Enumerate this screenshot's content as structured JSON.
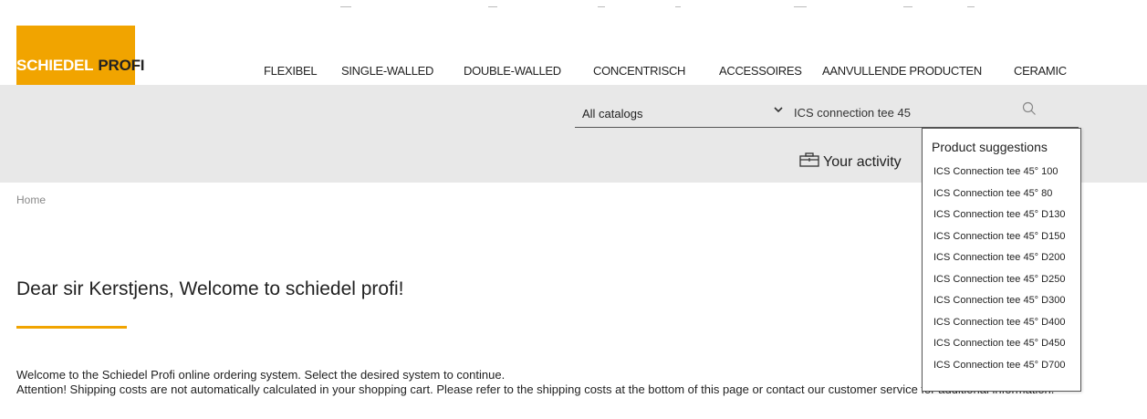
{
  "logo": {
    "word1": "SCHIEDEL",
    "word2": "PROFI"
  },
  "nav": [
    "FLEXIBEL",
    "SINGLE-WALLED",
    "DOUBLE-WALLED",
    "CONCENTRISCH",
    "ACCESSOIRES",
    "AANVULLENDE PRODUCTEN",
    "CERAMIC"
  ],
  "search": {
    "catalog": "All catalogs",
    "query": "ICS connection tee 45"
  },
  "activity": {
    "label": "Your activity"
  },
  "breadcrumb": {
    "home": "Home"
  },
  "main": {
    "title": "Dear sir Kerstjens, Welcome to schiedel profi!",
    "para1": "Welcome to the Schiedel Profi online ordering system. Select the desired system to continue.",
    "para2": "Attention! Shipping costs are not automatically calculated in your shopping cart. Please refer to the shipping costs at the bottom of this page or contact our customer service for additional information."
  },
  "suggestions": {
    "title": "Product suggestions",
    "items": [
      "ICS Connection tee 45° 100",
      "ICS Connection tee 45° 80",
      "ICS Connection tee 45° D130",
      "ICS Connection tee 45° D150",
      "ICS Connection tee 45° D200",
      "ICS Connection tee 45° D250",
      "ICS Connection tee 45° D300",
      "ICS Connection tee 45° D400",
      "ICS Connection tee 45° D450",
      "ICS Connection tee 45° D700"
    ]
  },
  "colors": {
    "brand": "#f1a400",
    "band": "#e8e8e8",
    "text": "#222222"
  },
  "icons": {
    "search": "search-icon",
    "chevron": "chevron-down-icon",
    "briefcase": "briefcase-icon"
  }
}
